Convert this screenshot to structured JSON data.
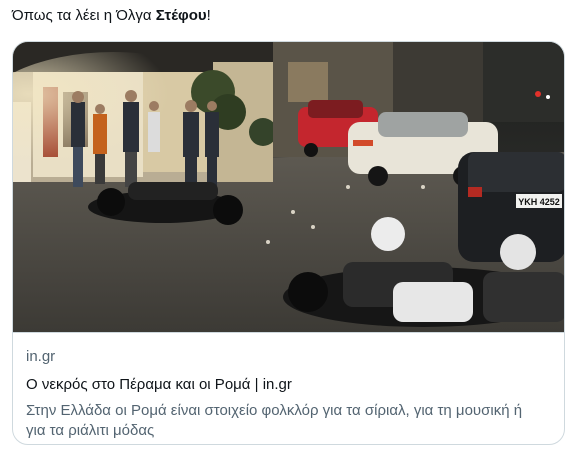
{
  "tweet": {
    "text_before": "Όπως τα λέει η Όλγα ",
    "text_bold": "Στέφου",
    "text_after": "!"
  },
  "card": {
    "image_alt": "Scene photo: motorcycles lying on the street at night, people standing near a shop, parked cars",
    "domain": "in.gr",
    "title": "Ο νεκρός στο Πέραμα και οι Ρομά | in.gr",
    "description": "Στην Ελλάδα οι Ρομά είναι στοιχείο φολκλόρ για τα σίριαλ, για τη μουσική ή για τα ριάλιτι μόδας",
    "plate_text": "ΥΚΗ 4252"
  }
}
